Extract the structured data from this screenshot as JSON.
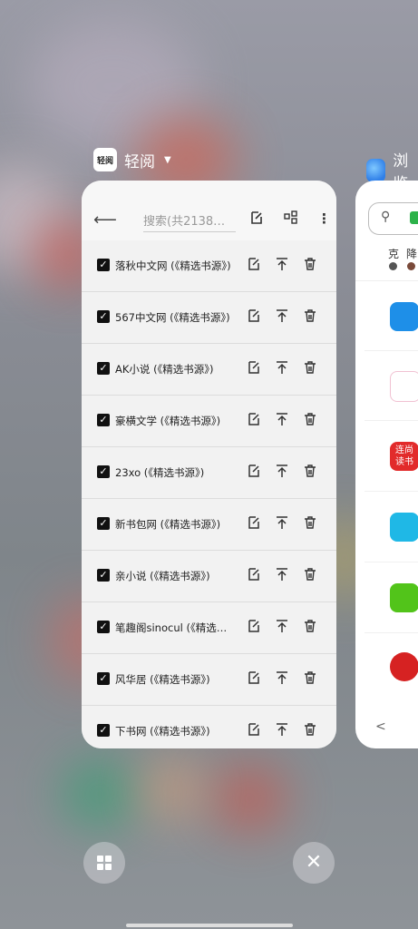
{
  "app": {
    "name": "轻阅",
    "icon_glyph": "轻阅"
  },
  "toolbar": {
    "search_placeholder": "搜索(共2138…"
  },
  "sources": [
    {
      "name": "落秋中文网 (《精选书源》)"
    },
    {
      "name": "567中文网 (《精选书源》)"
    },
    {
      "name": "AK小说 (《精选书源》)"
    },
    {
      "name": "豪横文学 (《精选书源》)"
    },
    {
      "name": "23xo (《精选书源》)"
    },
    {
      "name": "新书包网 (《精选书源》)"
    },
    {
      "name": "亲小说 (《精选书源》)"
    },
    {
      "name": "笔趣阁sinocul (《精选书…"
    },
    {
      "name": "风华居 (《精选书源》)"
    },
    {
      "name": "下书网 (《精选书源》)"
    }
  ],
  "app2": {
    "name": "浏览",
    "hot_words": [
      "克",
      "降"
    ],
    "tiles": [
      {
        "label": "",
        "color": "#1e8fe8"
      },
      {
        "label": "",
        "color": "#ffffff"
      },
      {
        "label": "连尚\n读书",
        "color": "#e22b2b"
      },
      {
        "label": "",
        "color": "#1fb8e6"
      },
      {
        "label": "",
        "color": "#52c41a"
      },
      {
        "label": "",
        "color": "#d62222"
      }
    ]
  }
}
